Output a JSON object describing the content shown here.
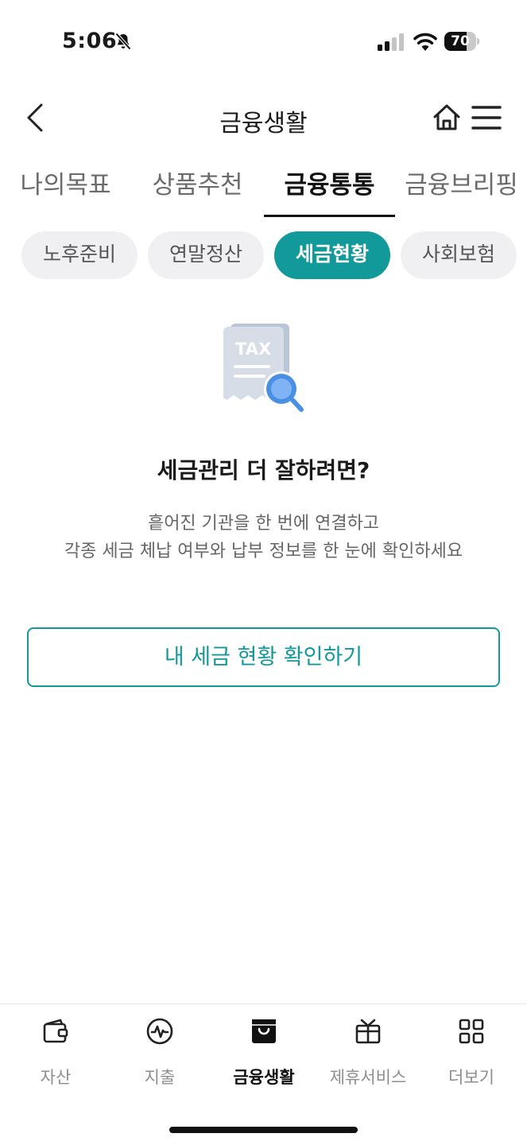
{
  "status_bar": {
    "time": "5:06",
    "battery": "70",
    "battery_level": 0.7,
    "icons": [
      "bell-muted-icon",
      "signal-icon",
      "wifi-icon",
      "battery-icon"
    ]
  },
  "header": {
    "title": "금융생활",
    "back_icon": "chevron-left-icon",
    "home_icon": "home-icon",
    "menu_icon": "hamburger-menu-icon"
  },
  "main_tabs": [
    {
      "label": "나의목표",
      "active": false
    },
    {
      "label": "상품추천",
      "active": false
    },
    {
      "label": "금융통통",
      "active": true
    },
    {
      "label": "금융브리핑",
      "active": false
    }
  ],
  "chips": [
    {
      "label": "노후준비",
      "active": false
    },
    {
      "label": "연말정산",
      "active": false
    },
    {
      "label": "세금현황",
      "active": true
    },
    {
      "label": "사회보험",
      "active": false
    }
  ],
  "content": {
    "illustration_text": "TAX",
    "heading": "세금관리 더 잘하려면?",
    "description_line1": "흩어진 기관을 한 번에 연결하고",
    "description_line2": "각종 세금 체납 여부와 납부 정보를 한 눈에 확인하세요",
    "button_label": "내 세금 현황 확인하기"
  },
  "bottom_nav": [
    {
      "label": "자산",
      "icon": "wallet-icon",
      "active": false
    },
    {
      "label": "지출",
      "icon": "pulse-icon",
      "active": false
    },
    {
      "label": "금융생활",
      "icon": "shopping-bag-icon",
      "active": true
    },
    {
      "label": "제휴서비스",
      "icon": "gift-icon",
      "active": false
    },
    {
      "label": "더보기",
      "icon": "grid-icon",
      "active": false
    }
  ],
  "colors": {
    "accent": "#12999a",
    "chip_bg": "#f0f0f3",
    "text_primary": "#1a1a1a",
    "text_secondary": "#666666"
  }
}
